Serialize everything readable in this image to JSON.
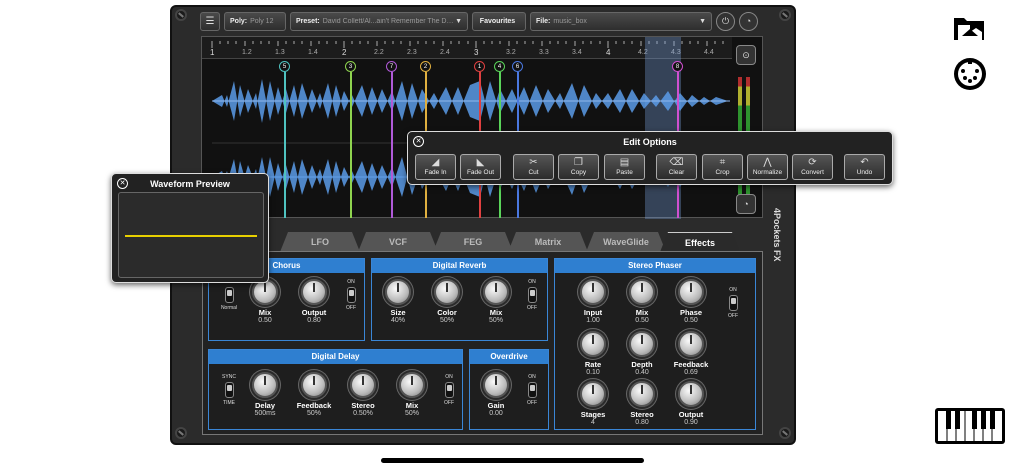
{
  "topbar": {
    "menu_icon": "menu-icon",
    "poly_label": "Poly:",
    "poly_value": "Poly 12",
    "preset_label": "Preset:",
    "preset_value": "David Collett/Al...ain't Remember The Dream",
    "favourites_label": "Favourites",
    "file_label": "File:",
    "file_value": "music_box"
  },
  "ruler": {
    "labels": [
      "1",
      "1.2",
      "1.3",
      "1.4",
      "2",
      "2.2",
      "2.3",
      "2.4",
      "3",
      "3.2",
      "3.3",
      "3.4",
      "4",
      "4.2",
      "4.3",
      "4.4"
    ]
  },
  "markers": [
    {
      "label": "5",
      "color": "#4fc3c0"
    },
    {
      "label": "3",
      "color": "#8fd44f"
    },
    {
      "label": "7",
      "color": "#b05ad8"
    },
    {
      "label": "2",
      "color": "#e0b040"
    },
    {
      "label": "1",
      "color": "#e04040"
    },
    {
      "label": "4",
      "color": "#5ad45a"
    },
    {
      "label": "6",
      "color": "#4a78e0"
    },
    {
      "label": "8",
      "color": "#d050d0"
    }
  ],
  "brand": "4Pockets FX",
  "tabs": [
    "LFO",
    "VCF",
    "FEG",
    "Matrix",
    "WaveGlide",
    "Effects"
  ],
  "active_tab": "Effects",
  "edit_options": {
    "title": "Edit Options",
    "buttons": [
      "Fade In",
      "Fade Out",
      "Cut",
      "Copy",
      "Paste",
      "Clear",
      "Crop",
      "Normalize",
      "Convert",
      "Undo"
    ]
  },
  "waveform_preview": {
    "title": "Waveform Preview"
  },
  "chorus": {
    "title": "Chorus",
    "switch_top": "Wide",
    "switch_bottom": "Normal",
    "mix_name": "Mix",
    "mix_value": "0.50",
    "output_name": "Output",
    "output_value": "0.80",
    "on": "ON",
    "off": "OFF"
  },
  "reverb": {
    "title": "Digital Reverb",
    "size_name": "Size",
    "size_value": "40%",
    "color_name": "Color",
    "color_value": "50%",
    "mix_name": "Mix",
    "mix_value": "50%",
    "on": "ON",
    "off": "OFF"
  },
  "phaser": {
    "title": "Stereo Phaser",
    "input_name": "Input",
    "input_value": "1.00",
    "mix_name": "Mix",
    "mix_value": "0.50",
    "phase_name": "Phase",
    "phase_value": "0.50",
    "rate_name": "Rate",
    "rate_value": "0.10",
    "depth_name": "Depth",
    "depth_value": "0.40",
    "feedback_name": "Feedback",
    "feedback_value": "0.69",
    "stages_name": "Stages",
    "stages_value": "4",
    "stereo_name": "Stereo",
    "stereo_value": "0.80",
    "output_name": "Output",
    "output_value": "0.90",
    "on": "ON",
    "off": "OFF"
  },
  "delay": {
    "title": "Digital Delay",
    "switch_top": "SYNC",
    "switch_bottom": "TIME",
    "delay_name": "Delay",
    "delay_value": "500ms",
    "feedback_name": "Feedback",
    "feedback_value": "50%",
    "stereo_name": "Stereo",
    "stereo_value": "0.50%",
    "mix_name": "Mix",
    "mix_value": "50%",
    "on": "ON",
    "off": "OFF"
  },
  "overdrive": {
    "title": "Overdrive",
    "gain_name": "Gain",
    "gain_value": "0.00",
    "on": "ON",
    "off": "OFF"
  },
  "colors": {
    "accent": "#2f7fd0",
    "waveform": "#5b9be8",
    "preview_line": "#e8d000"
  },
  "right_icons": [
    "folder-icon",
    "midi-icon",
    "keyboard-icon"
  ]
}
